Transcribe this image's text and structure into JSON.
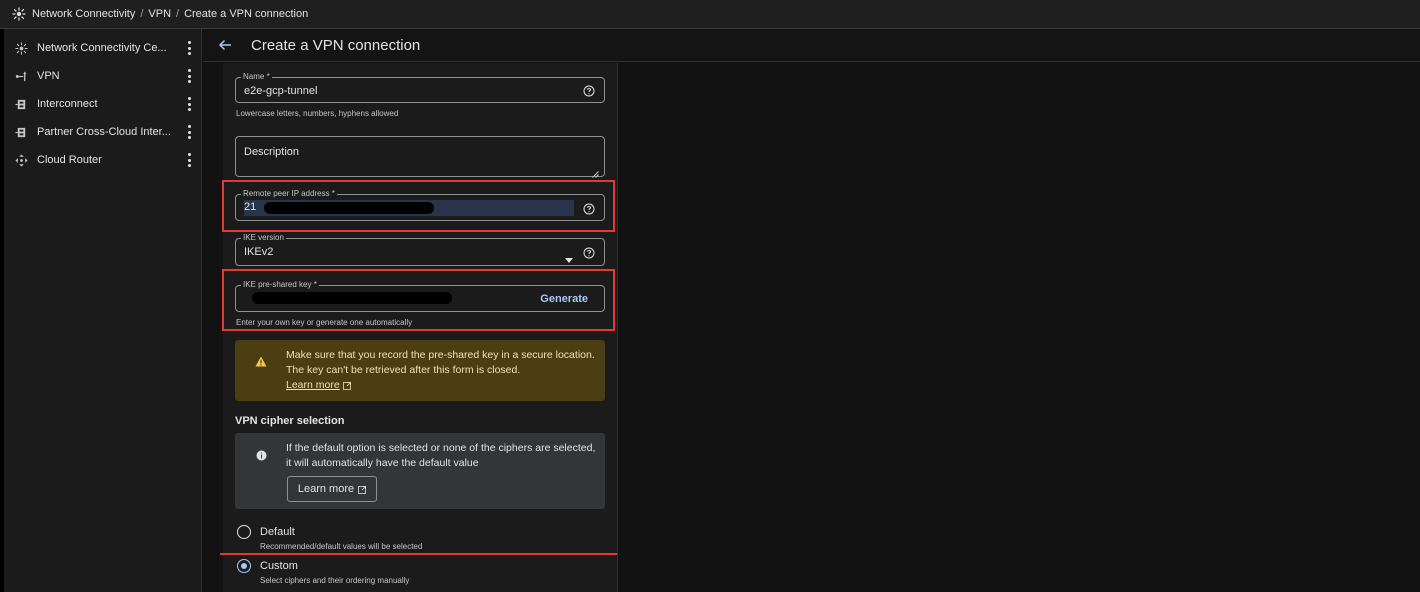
{
  "breadcrumb": {
    "items": [
      "Network Connectivity",
      "VPN",
      "Create a VPN connection"
    ],
    "separator": "/"
  },
  "sidebar": {
    "items": [
      {
        "label": "Network Connectivity Ce...",
        "icon": "network-connectivity-icon"
      },
      {
        "label": "VPN",
        "icon": "vpn-icon"
      },
      {
        "label": "Interconnect",
        "icon": "interconnect-icon"
      },
      {
        "label": "Partner Cross-Cloud Inter...",
        "icon": "partner-interconnect-icon"
      },
      {
        "label": "Cloud Router",
        "icon": "cloud-router-icon"
      }
    ]
  },
  "header": {
    "title": "Create a VPN connection",
    "back_icon": "arrow-back-icon"
  },
  "form": {
    "name": {
      "legend": "Name *",
      "value": "e2e-gcp-tunnel",
      "hint": "Lowercase letters, numbers, hyphens allowed"
    },
    "description": {
      "placeholder": "Description"
    },
    "remote_peer_ip": {
      "legend": "Remote peer IP address *",
      "value": "21"
    },
    "ike_version": {
      "legend": "IKE version",
      "value": "IKEv2"
    },
    "ike_key": {
      "legend": "IKE pre-shared key *",
      "generate_label": "Generate",
      "hint": "Enter your own key or generate one automatically"
    },
    "warning": {
      "text": "Make sure that you record the pre-shared key in a secure location. The key can't be retrieved after this form is closed.",
      "link": "Learn more"
    },
    "cipher": {
      "title": "VPN cipher selection",
      "info": "If the default option is selected or none of the ciphers are selected, it will automatically have the default value",
      "learn_more": "Learn more",
      "options": [
        {
          "label": "Default",
          "sub": "Recommended/default values will be selected",
          "checked": false
        },
        {
          "label": "Custom",
          "sub": "Select ciphers and their ordering manually",
          "checked": true
        }
      ]
    }
  },
  "colors": {
    "accent": "#a8c7fa",
    "highlight_red": "#e53935",
    "warning_bg": "#4a3e12",
    "info_bg": "#333537"
  }
}
